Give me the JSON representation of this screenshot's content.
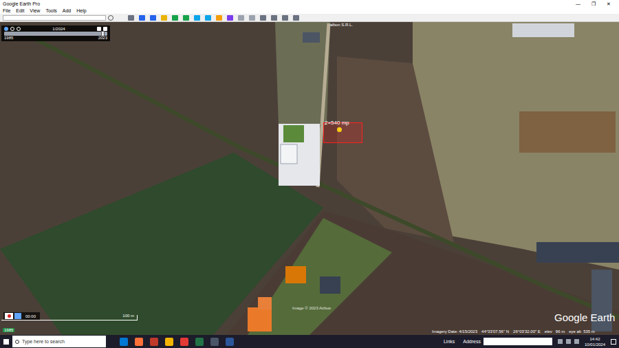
{
  "window": {
    "title": "Google Earth Pro",
    "controls": [
      "—",
      "❐",
      "✕"
    ]
  },
  "menu": [
    "File",
    "Edit",
    "View",
    "Tools",
    "Add",
    "Help"
  ],
  "history_panel": {
    "date": "1/2024",
    "start": "1985",
    "end": "2023",
    "level": 0.97
  },
  "placemarks": [
    {
      "label": "2×540 mp"
    },
    {
      "label": "albon S.R.L."
    }
  ],
  "tour": {
    "time": "00:00"
  },
  "scale": "100 m",
  "attribution": "Image © 2023 Airbus",
  "logo": "Google Earth",
  "status": {
    "imagery_date": "Imagery Date: 4/15/2023",
    "lat": "44°33'07.56\" N",
    "lon": "26°03'32.00\" E",
    "elev": "elev   96 m",
    "eye_alt": "eye alt  535 m"
  },
  "timeline_badge": "1985",
  "taskbar": {
    "search_placeholder": "Type here to search",
    "links": "Links",
    "address_label": "Address",
    "time": "14:42",
    "date": "10/01/2024"
  }
}
